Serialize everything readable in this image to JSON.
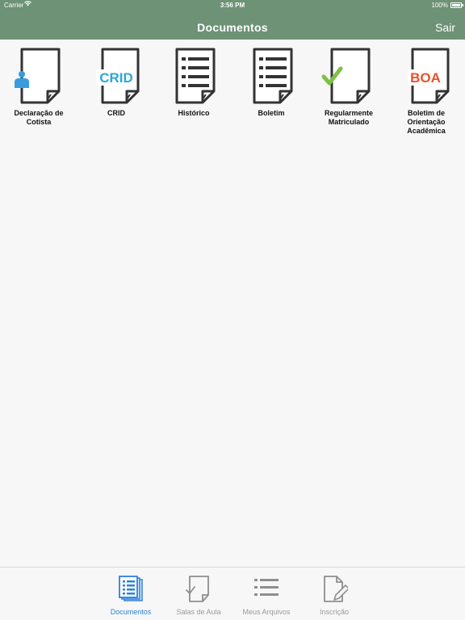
{
  "status_bar": {
    "carrier": "Carrier",
    "time": "3:56 PM",
    "battery": "100%"
  },
  "nav": {
    "title": "Documentos",
    "right_button": "Sair"
  },
  "documents": [
    {
      "label_1": "Declaração de",
      "label_2": "Cotista",
      "label_3": "",
      "icon": "person-icon"
    },
    {
      "label_1": "CRID",
      "label_2": "",
      "label_3": "",
      "icon": "crid-text-icon",
      "icon_text": "CRID"
    },
    {
      "label_1": "Histórico",
      "label_2": "",
      "label_3": "",
      "icon": "list-icon"
    },
    {
      "label_1": "Boletim",
      "label_2": "",
      "label_3": "",
      "icon": "list-icon"
    },
    {
      "label_1": "Regularmente",
      "label_2": "Matriculado",
      "label_3": "",
      "icon": "checkmark-icon"
    },
    {
      "label_1": "Boletim de",
      "label_2": "Orientação",
      "label_3": "Acadêmica",
      "icon": "boa-text-icon",
      "icon_text": "BOA"
    }
  ],
  "tabs": [
    {
      "label": "Documentos",
      "active": true
    },
    {
      "label": "Salas de Aula",
      "active": false
    },
    {
      "label": "Meus Arquivos",
      "active": false
    },
    {
      "label": "Inscrição",
      "active": false
    }
  ],
  "colors": {
    "header": "#6d9275",
    "active_tab": "#2f80d8",
    "crid": "#2ea6dc",
    "boa": "#e8522c",
    "check": "#7cc143",
    "person": "#3a9be0"
  }
}
